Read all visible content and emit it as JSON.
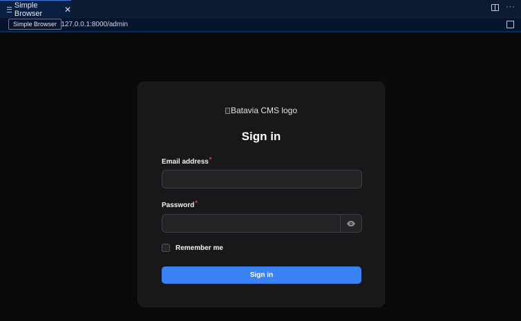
{
  "tab": {
    "label": "Simple Browser",
    "close_glyph": "✕"
  },
  "tooltip": "Simple Browser",
  "address": {
    "url": "://127.0.0.1:8000/admin"
  },
  "login": {
    "logo_alt": "Batavia CMS logo",
    "heading": "Sign in",
    "email_label": "Email address",
    "email_value": "",
    "password_label": "Password",
    "password_value": "",
    "required_mark": "*",
    "remember_label": "Remember me",
    "remember_checked": false,
    "submit_label": "Sign in"
  },
  "icons": {
    "tab": "list-icon",
    "close": "close-icon",
    "split": "split-editor-icon",
    "more": "more-actions-icon",
    "open_external": "open-external-icon",
    "password_toggle": "eye-icon"
  },
  "colors": {
    "accent": "#3b82f6",
    "required": "#ef4444",
    "card": "#18181b",
    "page_bg": "#0a0a0b"
  }
}
